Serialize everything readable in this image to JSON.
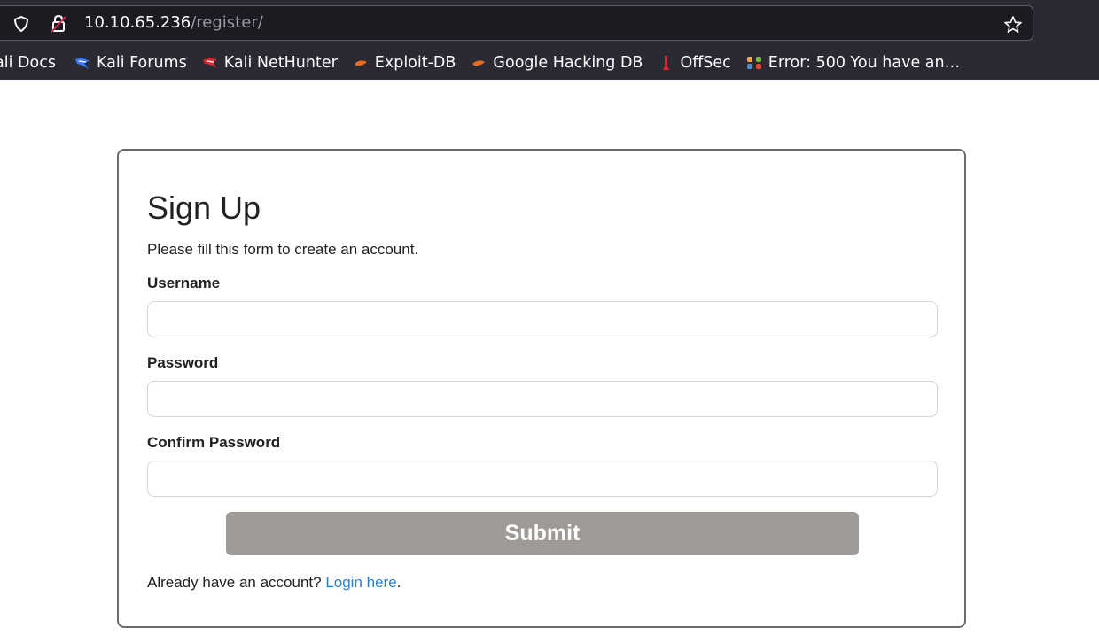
{
  "browser": {
    "url_host": "10.10.65.236",
    "url_path": "/register/",
    "bookmarks": [
      {
        "label": "ali Docs",
        "icon": "kali-docs-icon"
      },
      {
        "label": "Kali Forums",
        "icon": "kali-forums-icon"
      },
      {
        "label": "Kali NetHunter",
        "icon": "kali-nethunter-icon"
      },
      {
        "label": "Exploit-DB",
        "icon": "exploit-db-icon"
      },
      {
        "label": "Google Hacking DB",
        "icon": "google-hacking-db-icon"
      },
      {
        "label": "OffSec",
        "icon": "offsec-icon"
      },
      {
        "label": "Error: 500 You have an…",
        "icon": "joomla-icon"
      }
    ]
  },
  "form": {
    "title": "Sign Up",
    "subtitle": "Please fill this form to create an account.",
    "username_label": "Username",
    "username_value": "",
    "password_label": "Password",
    "password_value": "",
    "confirm_label": "Confirm Password",
    "confirm_value": "",
    "submit_label": "Submit",
    "footer_text": "Already have an account? ",
    "login_link": "Login here",
    "footer_end": "."
  },
  "colors": {
    "submit_bg": "#9e9a98",
    "link": "#2e7dd1",
    "chrome_bg": "#2b2a33"
  }
}
